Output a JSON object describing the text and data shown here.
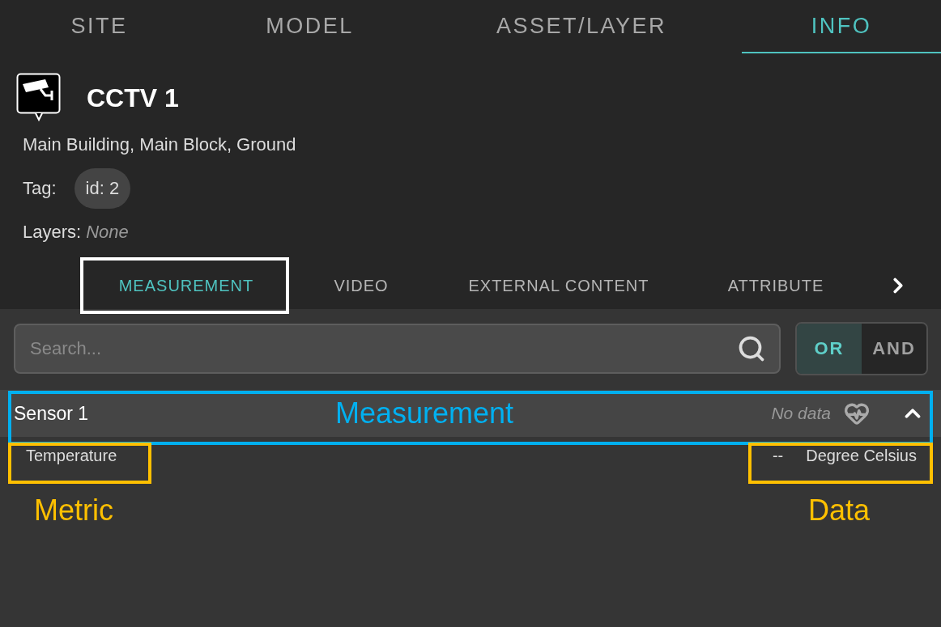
{
  "tabs": [
    {
      "label": "SITE",
      "selected": false
    },
    {
      "label": "MODEL",
      "selected": false
    },
    {
      "label": "ASSET/LAYER",
      "selected": false
    },
    {
      "label": "INFO",
      "selected": true
    }
  ],
  "asset": {
    "title": "CCTV 1",
    "location": "Main Building, Main Block, Ground",
    "tag_label": "Tag:",
    "tags": [
      "id: 2"
    ],
    "layers_label": "Layers:",
    "layers_value": "None"
  },
  "subtabs": [
    {
      "label": "MEASUREMENT",
      "selected": true
    },
    {
      "label": "VIDEO",
      "selected": false
    },
    {
      "label": "EXTERNAL CONTENT",
      "selected": false
    },
    {
      "label": "ATTRIBUTE",
      "selected": false
    }
  ],
  "search": {
    "placeholder": "Search..."
  },
  "logic": [
    {
      "label": "OR",
      "selected": true
    },
    {
      "label": "AND",
      "selected": false
    }
  ],
  "sensors": [
    {
      "name": "Sensor 1",
      "status": "No data",
      "expanded": true,
      "metrics": [
        {
          "name": "Temperature",
          "value": "--",
          "unit": "Degree Celsius"
        }
      ]
    }
  ],
  "annotations": [
    {
      "kind": "frame",
      "color": "#ffffff"
    },
    {
      "kind": "frame",
      "color": "#00b0f0",
      "label": "Measurement"
    },
    {
      "kind": "frame",
      "color": "#ffc000",
      "label": "Metric"
    },
    {
      "kind": "frame",
      "color": "#ffc000",
      "label": "Data"
    }
  ]
}
